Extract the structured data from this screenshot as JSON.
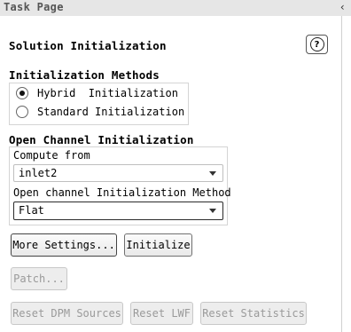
{
  "panel": {
    "title": "Task Page",
    "collapse_icon": "‹"
  },
  "section": {
    "title": "Solution Initialization",
    "help_symbol": "?"
  },
  "init_methods": {
    "label": "Initialization Methods",
    "options": [
      {
        "label": "Hybrid  Initialization",
        "selected": true
      },
      {
        "label": "Standard Initialization",
        "selected": false
      }
    ]
  },
  "open_channel": {
    "label": "Open Channel Initialization",
    "compute_from_label": "Compute from",
    "compute_from_value": "inlet2",
    "method_label": "Open channel Initialization Method",
    "method_value": "Flat"
  },
  "buttons": {
    "more_settings": "More Settings...",
    "initialize": "Initialize",
    "patch": "Patch...",
    "reset_dpm": "Reset DPM Sources",
    "reset_lwf": "Reset LWF",
    "reset_statistics": "Reset Statistics"
  }
}
